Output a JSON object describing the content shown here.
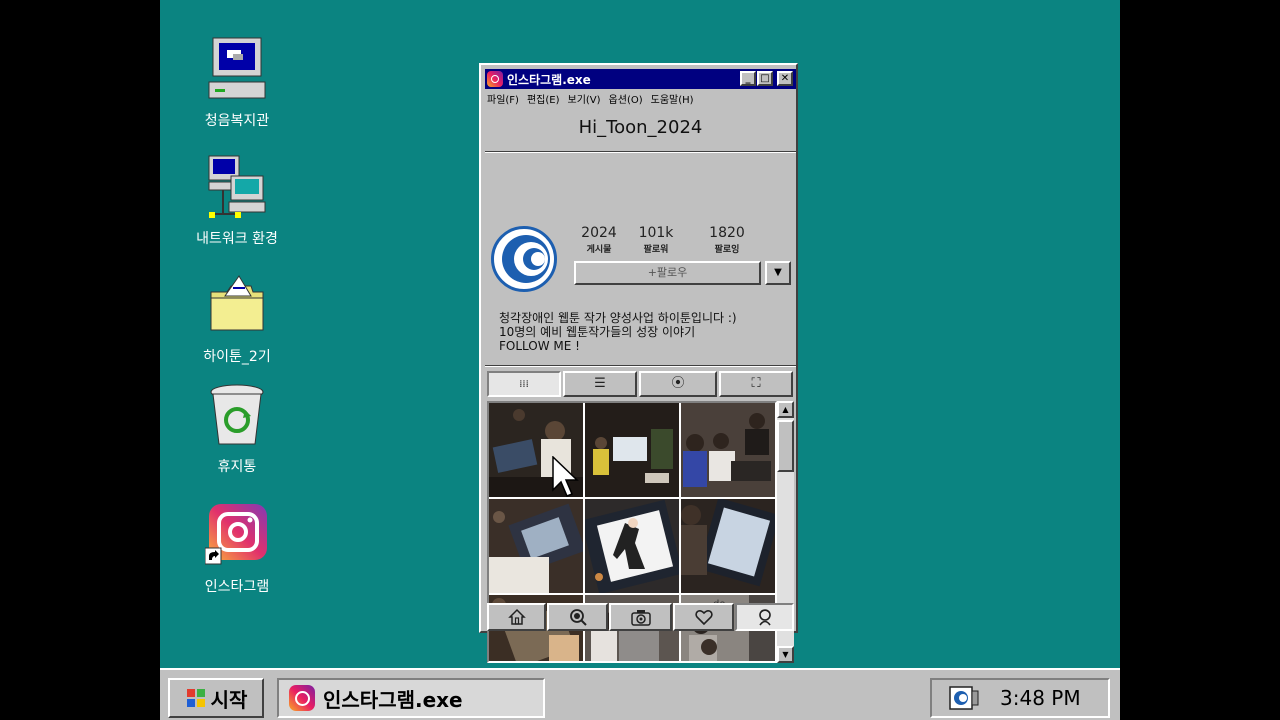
{
  "desktop": {
    "icons": [
      {
        "label": "청음복지관",
        "icon": "computer-icon"
      },
      {
        "label": "내트워크 환경",
        "icon": "network-icon"
      },
      {
        "label": "하이툰_2기",
        "icon": "folder-icon"
      },
      {
        "label": "휴지통",
        "icon": "recycle-bin-icon"
      },
      {
        "label": "인스타그램",
        "icon": "instagram-shortcut-icon"
      }
    ]
  },
  "window": {
    "title": "인스타그램.exe",
    "controls": {
      "minimize": "_",
      "maximize": "□",
      "close": "✕"
    },
    "menu": [
      "파일(F)",
      "편집(E)",
      "보기(V)",
      "옵션(O)",
      "도움말(H)"
    ]
  },
  "profile": {
    "username": "Hi_Toon_2024",
    "stats": [
      {
        "value": "2024",
        "caption": "게시물"
      },
      {
        "value": "101k",
        "caption": "팔로워"
      },
      {
        "value": "1820",
        "caption": "팔로잉"
      }
    ],
    "follow_label": "+팔로우",
    "dropdown_glyph": "▼",
    "bio": [
      "청각장애인 웹툰 작가 양성사업 하이툰입니다 :)",
      "10명의 예비 웹툰작가들의 성장 이야기",
      "FOLLOW ME !"
    ]
  },
  "tabs": [
    {
      "name": "grid",
      "icon": "grid-icon",
      "glyph": "⁞⁞⁞",
      "active": true
    },
    {
      "name": "list",
      "icon": "list-icon",
      "glyph": "☰",
      "active": false
    },
    {
      "name": "location",
      "icon": "location-pin-icon",
      "glyph": "⦿",
      "active": false
    },
    {
      "name": "tagged",
      "icon": "tagged-person-icon",
      "glyph": "⛶",
      "active": false
    }
  ],
  "grid_photos": [
    "drawing-tablet-photo",
    "classroom-screen-photo",
    "students-photo",
    "tablet-drawing-photo",
    "comic-character-tablet-photo",
    "tablet-sketch-photo",
    "drawing-table-photo",
    "student-cap-photo",
    "students-wall-photo"
  ],
  "scrollbar": {
    "up": "▲",
    "down": "▼"
  },
  "bottom_nav": [
    {
      "name": "home",
      "icon": "home-icon",
      "glyph": "⌂",
      "active": false
    },
    {
      "name": "search",
      "icon": "search-icon",
      "glyph": "⌕",
      "active": false
    },
    {
      "name": "camera",
      "icon": "camera-icon",
      "glyph": "◙",
      "active": false
    },
    {
      "name": "likes",
      "icon": "heart-icon",
      "glyph": "♡",
      "active": false
    },
    {
      "name": "profile",
      "icon": "profile-icon",
      "glyph": "☺",
      "active": true
    }
  ],
  "taskbar": {
    "start_label": "시작",
    "task_item": "인스타그램.exe",
    "clock": "3:48 PM"
  },
  "colors": {
    "desktop": "#0b8481",
    "titlebar": "#000080",
    "face": "#c0c0c0",
    "avatar_blue": "#1d5fb0"
  }
}
